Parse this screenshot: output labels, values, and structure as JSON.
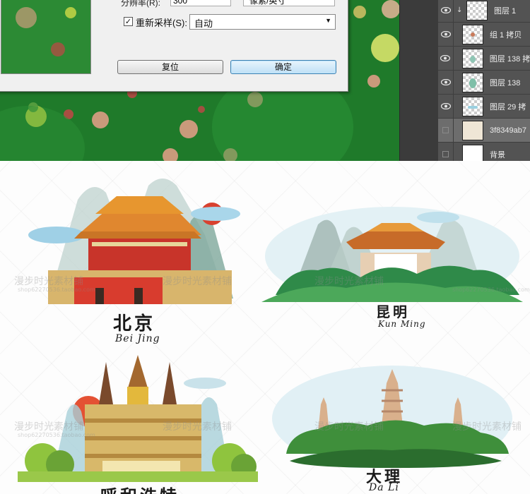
{
  "dialog": {
    "resolution_label": "分辨率(R):",
    "resolution_value": "300",
    "resolution_unit": "像素/英寸",
    "resample_label": "重新采样(S):",
    "resample_checked": "✓",
    "resample_value": "自动",
    "reset_label": "复位",
    "ok_label": "确定"
  },
  "layers": [
    {
      "name": "图层 1",
      "selected": false,
      "visible": true
    },
    {
      "name": "组 1 拷贝",
      "selected": false,
      "visible": true
    },
    {
      "name": "图层 138 拷",
      "selected": false,
      "visible": true
    },
    {
      "name": "图层 138",
      "selected": false,
      "visible": true
    },
    {
      "name": "图层 29 拷",
      "selected": false,
      "visible": true
    },
    {
      "name": "3f8349ab7",
      "selected": true,
      "visible": false
    },
    {
      "name": "背景",
      "selected": false,
      "visible": false
    }
  ],
  "cities": {
    "beijing": {
      "name": "北京",
      "pinyin": "Bei Jing"
    },
    "kunming": {
      "name": "昆明",
      "pinyin": "Kun Ming"
    },
    "hohhot": {
      "name": "呼和浩特"
    },
    "dali": {
      "name": "大理",
      "pinyin": "Da Li"
    }
  },
  "watermark": {
    "shop_text": "漫步时光素材铺",
    "shop_url": "shop62270536.taobao.com"
  },
  "colors": {
    "canvas_green": "#1f7a2a",
    "panel_gray": "#535353",
    "dialog_bg": "#f0f0f0"
  }
}
